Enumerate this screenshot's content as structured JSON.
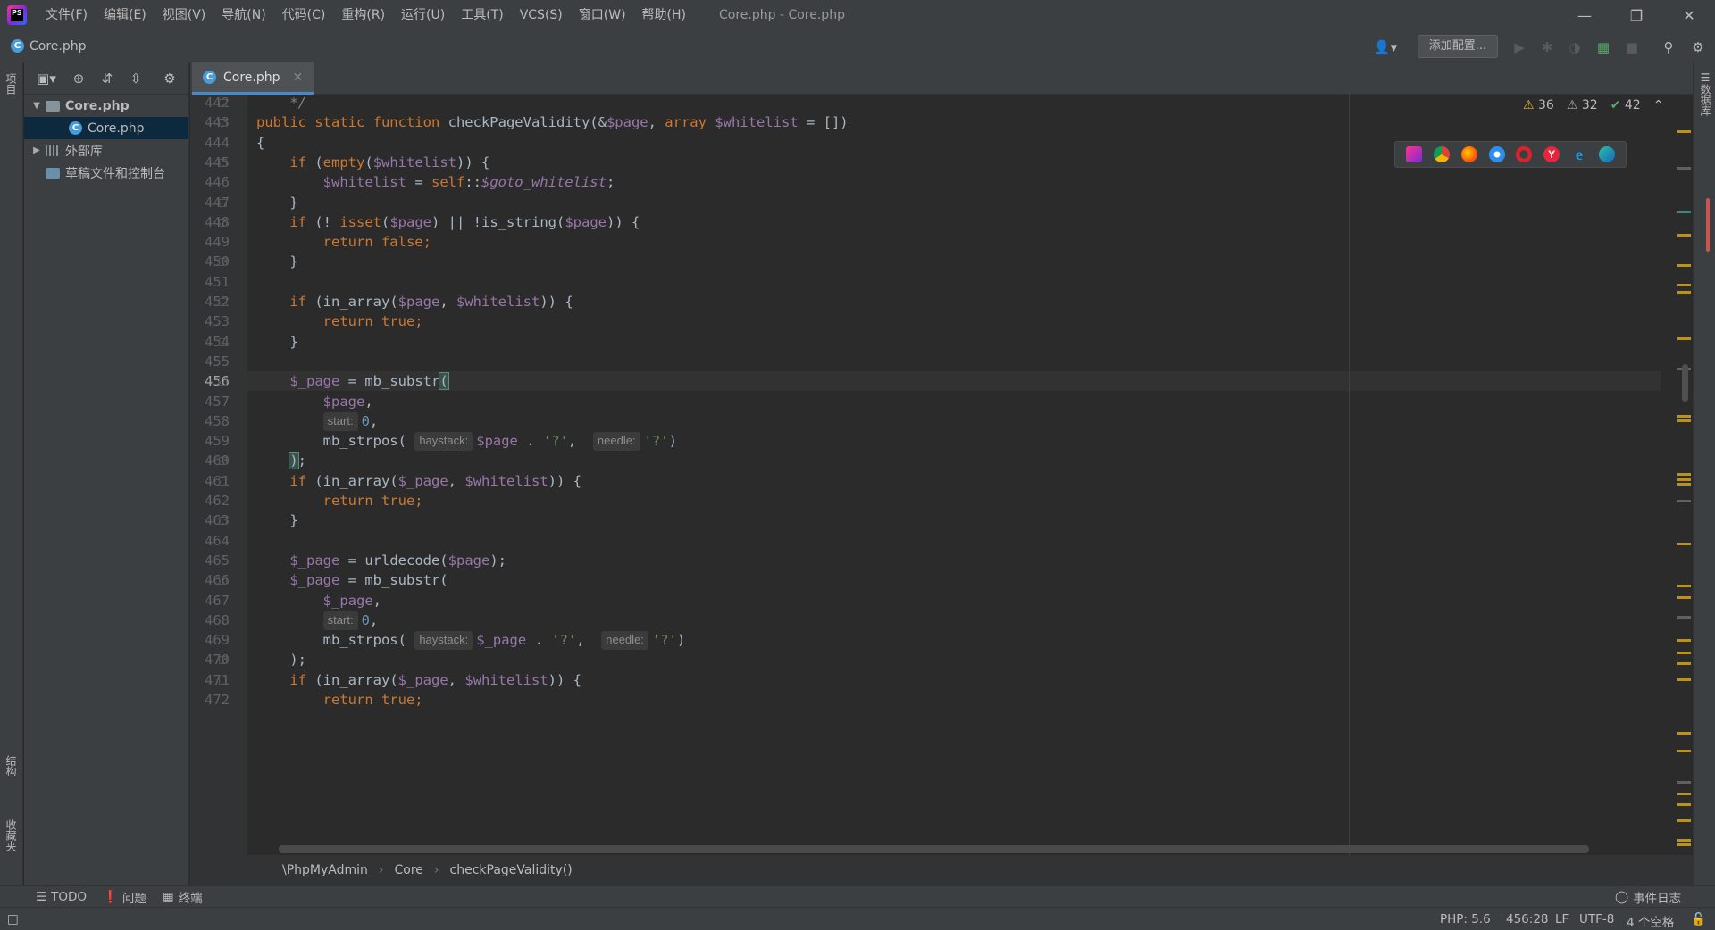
{
  "menu": {
    "items": [
      "文件(F)",
      "编辑(E)",
      "视图(V)",
      "导航(N)",
      "代码(C)",
      "重构(R)",
      "运行(U)",
      "工具(T)",
      "VCS(S)",
      "窗口(W)",
      "帮助(H)"
    ],
    "window_title": "Core.php - Core.php",
    "logo_text": "PS"
  },
  "navbar": {
    "file": "Core.php",
    "run_config": "添加配置..."
  },
  "left_strip": {
    "project": "项目",
    "structure": "结构",
    "favorites": "收藏夹"
  },
  "right_strip": {
    "database": "数据库"
  },
  "project_tree": [
    {
      "label": "Core.php",
      "kind": "folder",
      "arrow": "▼",
      "indent": 0
    },
    {
      "label": "Core.php",
      "kind": "php",
      "arrow": "",
      "indent": 1,
      "selected": true
    },
    {
      "label": "外部库",
      "kind": "library",
      "arrow": "▶",
      "indent": 0
    },
    {
      "label": "草稿文件和控制台",
      "kind": "scratch",
      "arrow": "",
      "indent": 0
    }
  ],
  "editor": {
    "tab": "Core.php",
    "inspections": {
      "warnings": "36",
      "weak_warnings": "32",
      "ok": "42"
    },
    "current_line": "456",
    "lines": [
      {
        "n": "442",
        "html": "    <span class=\"cmt\">*/</span>"
      },
      {
        "n": "443",
        "html": "<span class=\"kw\">public static function </span><span class=\"fn\">checkPageValidity</span>(&amp;<span class=\"var\">$page</span>, <span class=\"kw\">array </span><span class=\"var\">$whitelist</span> = [])"
      },
      {
        "n": "444",
        "html": "{"
      },
      {
        "n": "445",
        "html": "    <span class=\"kw\">if </span>(<span class=\"kw\">empty</span>(<span class=\"var\">$whitelist</span>)) {"
      },
      {
        "n": "446",
        "html": "        <span class=\"var\">$whitelist</span> = <span class=\"kw\">self</span>::<span class=\"var ital\">$goto_whitelist</span>;"
      },
      {
        "n": "447",
        "html": "    }"
      },
      {
        "n": "448",
        "html": "    <span class=\"kw\">if </span>(! <span class=\"kw\">isset</span>(<span class=\"var\">$page</span>) || !is_string(<span class=\"var\">$page</span>)) {"
      },
      {
        "n": "449",
        "html": "        <span class=\"kw\">return false;</span>"
      },
      {
        "n": "450",
        "html": "    }"
      },
      {
        "n": "451",
        "html": ""
      },
      {
        "n": "452",
        "html": "    <span class=\"kw\">if </span>(in_array(<span class=\"var\">$page</span>, <span class=\"var\">$whitelist</span>)) {"
      },
      {
        "n": "453",
        "html": "        <span class=\"kw\">return true;</span>"
      },
      {
        "n": "454",
        "html": "    }"
      },
      {
        "n": "455",
        "html": ""
      },
      {
        "n": "456",
        "html": "    <span class=\"var\">$_page</span> = mb_substr<span class=\"brace-match\">(</span>"
      },
      {
        "n": "457",
        "html": "        <span class=\"var\">$page</span>,"
      },
      {
        "n": "458",
        "html": "        <span class=\"hint\">start:</span><span class=\"num\">0</span>,"
      },
      {
        "n": "459",
        "html": "        mb_strpos( <span class=\"hint\">haystack:</span><span class=\"var\">$page</span> . <span class=\"str\">'?'</span>,  <span class=\"hint\">needle:</span><span class=\"str\">'?'</span>)"
      },
      {
        "n": "460",
        "html": "    <span class=\"brace-match\">)</span>;"
      },
      {
        "n": "461",
        "html": "    <span class=\"kw\">if </span>(in_array(<span class=\"var\">$_page</span>, <span class=\"var\">$whitelist</span>)) {"
      },
      {
        "n": "462",
        "html": "        <span class=\"kw\">return true;</span>"
      },
      {
        "n": "463",
        "html": "    }"
      },
      {
        "n": "464",
        "html": ""
      },
      {
        "n": "465",
        "html": "    <span class=\"var\">$_page</span> = urldecode(<span class=\"var\">$page</span>);"
      },
      {
        "n": "466",
        "html": "    <span class=\"var\">$_page</span> = mb_substr("
      },
      {
        "n": "467",
        "html": "        <span class=\"var\">$_page</span>,"
      },
      {
        "n": "468",
        "html": "        <span class=\"hint\">start:</span><span class=\"num\">0</span>,"
      },
      {
        "n": "469",
        "html": "        mb_strpos( <span class=\"hint\">haystack:</span><span class=\"var\">$_page</span> . <span class=\"str\">'?'</span>,  <span class=\"hint\">needle:</span><span class=\"str\">'?'</span>)"
      },
      {
        "n": "470",
        "html": "    );"
      },
      {
        "n": "471",
        "html": "    <span class=\"kw\">if </span>(in_array(<span class=\"var\">$_page</span>, <span class=\"var\">$whitelist</span>)) {"
      },
      {
        "n": "472",
        "html": "        <span class=\"kw\">return true;</span>"
      }
    ]
  },
  "breadcrumb": [
    "\\PhpMyAdmin",
    "Core",
    "checkPageValidity()"
  ],
  "tool_windows": {
    "todo": "TODO",
    "problems": "问题",
    "terminal": "终端",
    "event_log": "事件日志"
  },
  "status": {
    "php": "PHP: 5.6",
    "position": "456:28",
    "line_sep": "LF",
    "encoding": "UTF-8",
    "indent": "4 个空格"
  },
  "colors": {
    "keyword": "#cc7832",
    "variable": "#9876aa",
    "string": "#6a8759",
    "number": "#6897bb",
    "comment": "#808080",
    "background": "#2b2b2b"
  }
}
